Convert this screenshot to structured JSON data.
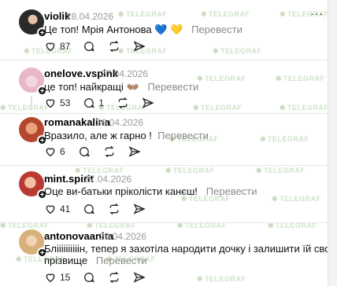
{
  "watermark_text": "TELEGRAF",
  "comments": [
    {
      "username": "violik",
      "date": "28.04.2026",
      "text": "Це топ! Мрія Антонова 💙 💛",
      "translate": "Перевести",
      "likes": "87",
      "replies": "",
      "avatar_color": "#2a2a2a"
    },
    {
      "username": "onelove.vspink",
      "date": "27.04.2026",
      "text": "це топ! найкращі 👐🏽",
      "translate": "Перевести",
      "likes": "53",
      "replies": "1",
      "avatar_color": "#e9b8c8"
    },
    {
      "username": "romanakalina",
      "date": "28.04.2026",
      "text": "Вразило, але ж гарно !",
      "translate": "Перевести",
      "likes": "6",
      "replies": "",
      "avatar_color": "#c25a3c"
    },
    {
      "username": "mint.spirit",
      "date": "27.04.2026",
      "text": "Оце ви-батьки пріколісти канєш!",
      "translate": "Перевести",
      "likes": "41",
      "replies": "",
      "avatar_color": "#b83a32"
    },
    {
      "username": "antonovaanita",
      "date": "28.04.2026",
      "text_line1": "Бліііііііііін, тепер я захотіла народити дочку і залишити їй своє",
      "text_line2": "прізвище",
      "translate": "Перевести",
      "likes": "15",
      "replies": "",
      "avatar_color": "#d8b07a"
    }
  ]
}
